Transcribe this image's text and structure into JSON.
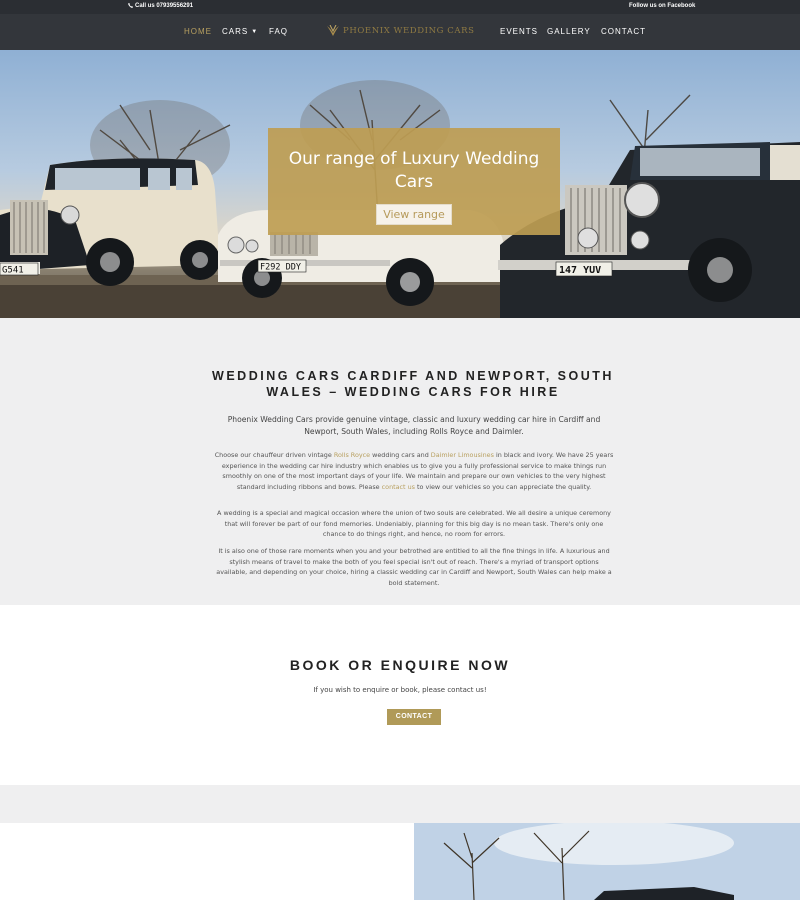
{
  "topbar": {
    "phone_text": "Call us 07939556291",
    "facebook_text": "Follow us on Facebook"
  },
  "nav": {
    "home": "HOME",
    "cars": "CARS",
    "faq": "FAQ",
    "logo_text": "PHOENIX WEDDING CARS",
    "events": "EVENTS",
    "gallery": "GALLERY",
    "contact": "CONTACT"
  },
  "hero": {
    "heading": "Our range of Luxury Wedding Cars",
    "button": "View range",
    "plates": [
      "G541",
      "F292 DDY",
      "147 YUV"
    ]
  },
  "intro": {
    "heading": "WEDDING CARS CARDIFF AND NEWPORT, SOUTH WALES – WEDDING CARS FOR HIRE",
    "lead": "Phoenix Wedding Cars provide genuine vintage, classic and luxury wedding car hire in Cardiff and Newport, South Wales, including Rolls Royce and Daimler.",
    "p1_a": "Choose our chauffeur driven vintage ",
    "p1_link1": "Rolls Royce",
    "p1_b": " wedding cars and ",
    "p1_link2": "Daimler Limousines",
    "p1_c": " in black and ivory. We have 25 years experience in the wedding car hire industry which enables us to give you a fully professional service to make things run smoothly on one of the most important days of your life. We maintain and prepare our own vehicles to the very highest standard including ribbons and bows. Please ",
    "p1_link3": "contact us",
    "p1_d": " to view our vehicles so you can appreciate the quality.",
    "p2": "A wedding is a special and magical occasion where the union of two souls are celebrated. We all desire a unique ceremony that will forever be part of our fond memories. Undeniably, planning for this big day is no mean task. There's only one chance to do things right, and hence, no room for errors.",
    "p3": "It is also one of those rare moments when you and your betrothed are entitled to all the fine things in life. A luxurious and stylish means of travel to make the both of you feel special isn't out of reach. There's a myriad of transport options available, and depending on your choice, hiring a classic wedding car in Cardiff and Newport, South Wales can help make a bold statement."
  },
  "book": {
    "heading": "BOOK OR ENQUIRE NOW",
    "sub": "If you wish to enquire or book, please contact us!",
    "button": "CONTACT"
  },
  "colors": {
    "accent": "#b8a060",
    "nav_bg": "#33363b",
    "topbar_bg": "#2b2e33",
    "section_bg": "#efeff0"
  }
}
